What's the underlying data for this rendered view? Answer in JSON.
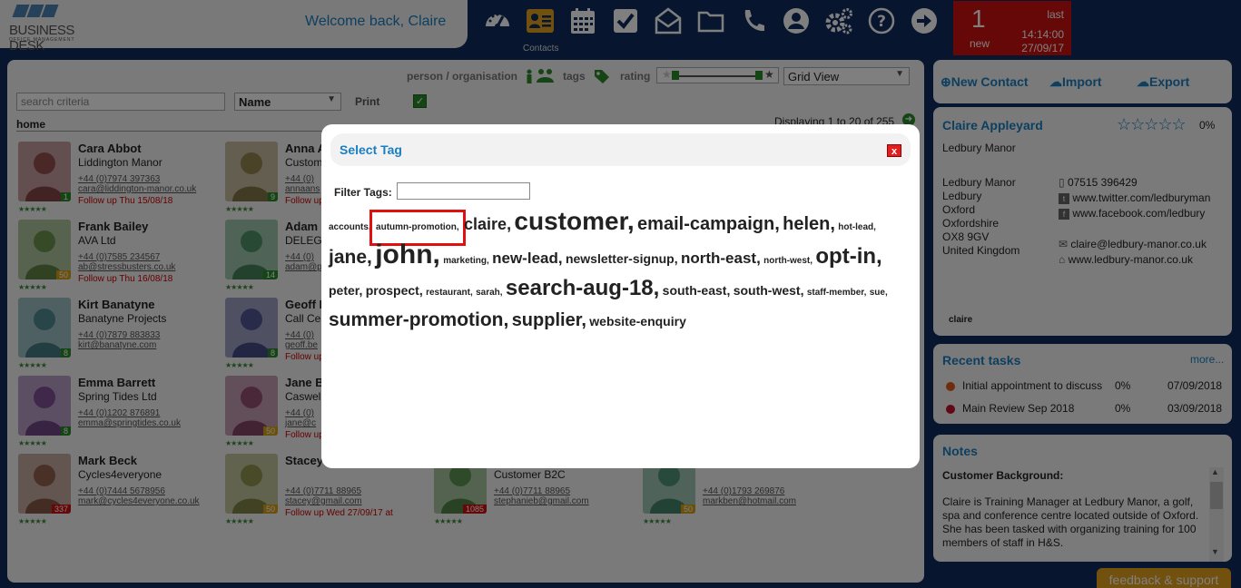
{
  "header": {
    "logo_text": "BUSINESS DESK",
    "logo_subtext": "OFFICE MANAGEMENT",
    "welcome": "Welcome back, Claire",
    "active_nav_label": "Contacts",
    "nav_icons": [
      "dashboard-icon",
      "contacts-icon",
      "calendar-icon",
      "tasks-icon",
      "mail-icon",
      "folder-icon",
      "phone-icon",
      "user-icon",
      "settings-icon",
      "help-icon",
      "logout-icon"
    ],
    "notification": {
      "count": "1",
      "count_label": "new",
      "last_label": "last",
      "time": "14:14:00",
      "date": "27/09/17"
    }
  },
  "toolbar": {
    "filter_label": "person / organisation",
    "tags_label": "tags",
    "rating_label": "rating",
    "view_select": "Grid View",
    "search_placeholder": "search criteria",
    "sort_select": "Name",
    "print_label": "Print",
    "breadcrumb": "home",
    "displaying": "Displaying 1 to 20 of 255"
  },
  "contacts": [
    {
      "name": "Cara Abbot",
      "org": "Liddington Manor",
      "tel": "+44 (0)7974 397363",
      "email": "cara@liddington-manor.co.uk",
      "followup": "Follow up Thu 15/08/18",
      "badge": "1",
      "badge_color": "#2a8a2a"
    },
    {
      "name": "Anna A",
      "org": "Custom",
      "tel": "+44 (0)",
      "email": "annaans",
      "followup": "Follow up",
      "badge": "9",
      "badge_color": "#2a8a2a"
    },
    {
      "name": "Frank Bailey",
      "org": "AVA Ltd",
      "tel": "+44 (0)7585 234567",
      "email": "ab@stressbusters.co.uk",
      "followup": "Follow up Thu 16/08/18",
      "badge": "50",
      "badge_color": "#d4a017"
    },
    {
      "name": "Adam",
      "org": "DELEG",
      "tel": "+44 (0)",
      "email": "adam@p",
      "followup": "",
      "badge": "14",
      "badge_color": "#2a8a2a"
    },
    {
      "name": "Kirt Banatyne",
      "org": "Banatyne Projects",
      "tel": "+44 (0)7879 883833",
      "email": "kirt@banatyne.com",
      "followup": "",
      "badge": "8",
      "badge_color": "#2a8a2a"
    },
    {
      "name": "Geoff B",
      "org": "Call Ce",
      "tel": "+44 (0)",
      "email": "geoff.be",
      "followup": "Follow up",
      "badge": "8",
      "badge_color": "#2a8a2a"
    },
    {
      "name": "Emma Barrett",
      "org": "Spring Tides Ltd",
      "tel": "+44 (0)1202 876891",
      "email": "emma@springtides.co.uk",
      "followup": "",
      "badge": "8",
      "badge_color": "#2a8a2a"
    },
    {
      "name": "Jane B",
      "org": "Caswel",
      "tel": "+44 (0)",
      "email": "jane@c",
      "followup": "Follow up",
      "badge": "50",
      "badge_color": "#d4a017"
    },
    {
      "name": "Mark Beck",
      "org": "Cycles4everyone",
      "tel": "+44 (0)7444 5678956",
      "email": "mark@cycles4everyone.co.uk",
      "followup": "",
      "badge": "337",
      "badge_color": "#cc1111"
    },
    {
      "name": "Stacey",
      "org": "",
      "tel": "+44 (0)7711 88965",
      "email": "stacey@gmail.com",
      "followup": "Follow up Wed 27/09/17 at",
      "badge": "50",
      "badge_color": "#d4a017"
    },
    {
      "name": "",
      "org": "Customer B2C",
      "tel": "+44 (0)7711 88965",
      "email": "stephanieb@gmail.com",
      "followup": "",
      "badge": "1085",
      "badge_color": "#cc1111"
    },
    {
      "name": "",
      "org": "",
      "tel": "+44 (0)1793 269876",
      "email": "markben@hotmail.com",
      "followup": "",
      "badge": "50",
      "badge_color": "#d4a017"
    }
  ],
  "actions": {
    "new_contact": "New Contact",
    "import": "Import",
    "export": "Export"
  },
  "detail": {
    "name": "Claire Appleyard",
    "percent": "0%",
    "company": "Ledbury Manor",
    "address": [
      "Ledbury Manor",
      "Ledbury",
      "Oxford",
      "Oxfordshire",
      "OX8 9GV",
      "United Kingdom"
    ],
    "phone": "07515 396429",
    "twitter": "www.twitter.com/ledburyman",
    "facebook": "www.facebook.com/ledbury",
    "email": "claire@ledbury-manor.co.uk",
    "website": "www.ledbury-manor.co.uk",
    "owner": "claire"
  },
  "tasks": {
    "title": "Recent tasks",
    "more": "more...",
    "items": [
      {
        "name": "Initial appointment to discuss",
        "pct": "0%",
        "date": "07/09/2018",
        "color": "#e05a1a"
      },
      {
        "name": "Main Review Sep 2018",
        "pct": "0%",
        "date": "03/09/2018",
        "color": "#c0102a"
      }
    ]
  },
  "notes": {
    "title": "Notes",
    "heading": "Customer Background:",
    "body": "Claire is Training Manager at Ledbury Manor, a golf, spa and conference centre located outside of Oxford.  She has been tasked with organizing training for 100 members of staff in H&S."
  },
  "feedback": "feedback & support",
  "modal": {
    "title": "Select Tag",
    "close": "x",
    "filter_label": "Filter Tags:",
    "filter_value": "",
    "tags": [
      {
        "t": "accounts",
        "s": 10
      },
      {
        "t": "autumn-promotion",
        "s": 10,
        "sel": true
      },
      {
        "t": "claire",
        "s": 18
      },
      {
        "t": "customer",
        "s": 28
      },
      {
        "t": "email-campaign",
        "s": 20
      },
      {
        "t": "helen",
        "s": 20
      },
      {
        "t": "hot-lead",
        "s": 10
      },
      {
        "t": "jane",
        "s": 21
      },
      {
        "t": "john",
        "s": 30
      },
      {
        "t": "marketing",
        "s": 10
      },
      {
        "t": "new-lead",
        "s": 17
      },
      {
        "t": "newsletter-signup",
        "s": 14
      },
      {
        "t": "north-east",
        "s": 17
      },
      {
        "t": "north-west",
        "s": 10
      },
      {
        "t": "opt-in",
        "s": 24
      },
      {
        "t": "peter",
        "s": 14
      },
      {
        "t": "prospect",
        "s": 14
      },
      {
        "t": "restaurant",
        "s": 10
      },
      {
        "t": "sarah",
        "s": 10
      },
      {
        "t": "search-aug-18",
        "s": 24
      },
      {
        "t": "south-east",
        "s": 14
      },
      {
        "t": "south-west",
        "s": 14
      },
      {
        "t": "staff-member",
        "s": 10
      },
      {
        "t": "sue",
        "s": 10
      },
      {
        "t": "summer-promotion",
        "s": 21
      },
      {
        "t": "supplier",
        "s": 20
      },
      {
        "t": "website-enquiry",
        "s": 14
      }
    ]
  }
}
